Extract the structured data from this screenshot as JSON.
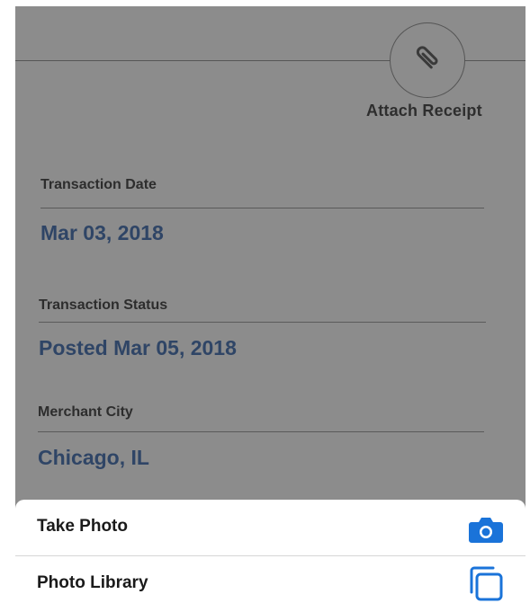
{
  "attach": {
    "label": "Attach Receipt",
    "icon": "paperclip-icon"
  },
  "fields": [
    {
      "label": "Transaction Date",
      "value": "Mar 03, 2018"
    },
    {
      "label": "Transaction Status",
      "value": "Posted Mar 05, 2018"
    },
    {
      "label": "Merchant City",
      "value": "Chicago, IL"
    }
  ],
  "action_sheet": {
    "items": [
      {
        "label": "Take Photo",
        "icon": "camera-icon"
      },
      {
        "label": "Photo Library",
        "icon": "photo-library-icon"
      }
    ]
  },
  "colors": {
    "overlay_background": "#8c8c8c",
    "value_text": "#2f4566",
    "icon_accent": "#1a73d9"
  }
}
